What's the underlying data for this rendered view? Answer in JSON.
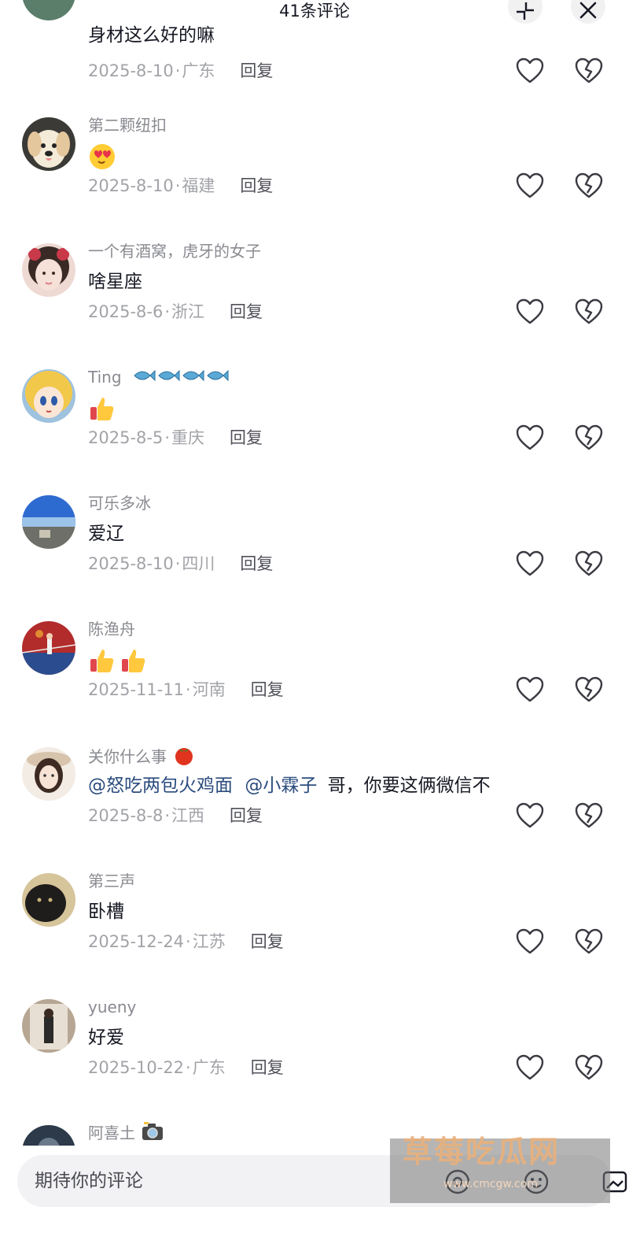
{
  "header": {
    "title": "41条评论"
  },
  "comments": [
    {
      "username": "",
      "content": "身材这么好的嘛",
      "date": "2025-8-10",
      "location": "广东",
      "reply": "回复",
      "avatar": "partial-avatar"
    },
    {
      "username": "第二颗纽扣",
      "content": "",
      "emoji": [
        "heart-eyes-emoji"
      ],
      "date": "2025-8-10",
      "location": "福建",
      "reply": "回复",
      "avatar": "puppy-avatar"
    },
    {
      "username": "一个有酒窝，虎牙的女子",
      "content": "啥星座",
      "date": "2025-8-6",
      "location": "浙江",
      "reply": "回复",
      "avatar": "girl-bow-avatar"
    },
    {
      "username": "Ting",
      "username_suffix_icons": [
        "fish-icon",
        "fish-icon",
        "fish-icon",
        "fish-icon"
      ],
      "content": "",
      "emoji": [
        "thumbs-up-emoji"
      ],
      "date": "2025-8-5",
      "location": "重庆",
      "reply": "回复",
      "avatar": "anime-girl-avatar"
    },
    {
      "username": "可乐多冰",
      "content": "爱辽",
      "date": "2025-8-10",
      "location": "四川",
      "reply": "回复",
      "avatar": "sky-landscape-avatar"
    },
    {
      "username": "陈渔舟",
      "content": "",
      "emoji": [
        "thumbs-up-emoji",
        "thumbs-up-emoji"
      ],
      "date": "2025-11-11",
      "location": "河南",
      "reply": "回复",
      "avatar": "basketball-avatar"
    },
    {
      "username": "关你什么事",
      "username_suffix_icons": [
        "tomato-icon"
      ],
      "mentions": [
        "@怒吃两包火鸡面",
        "@小霖子"
      ],
      "content": "哥，你要这俩微信不",
      "date": "2025-8-8",
      "location": "江西",
      "reply": "回复",
      "avatar": "girl-hat-avatar"
    },
    {
      "username": "第三声",
      "content": "卧槽",
      "date": "2025-12-24",
      "location": "江苏",
      "reply": "回复",
      "avatar": "dark-cat-avatar"
    },
    {
      "username": "yueny",
      "content": "好爱",
      "date": "2025-10-22",
      "location": "广东",
      "reply": "回复",
      "avatar": "mirror-selfie-avatar"
    },
    {
      "username": "阿喜土",
      "username_suffix_icons": [
        "camera-icon"
      ],
      "content": "",
      "date": "",
      "location": "",
      "reply": "",
      "avatar": "dark-avatar"
    }
  ],
  "input": {
    "placeholder": "期待你的评论"
  },
  "watermark": {
    "title": "草莓吃瓜网",
    "url": "www.cmcgw.com"
  },
  "colors": {
    "username": "#8a8b91",
    "meta": "#a2a3a8",
    "mention": "#2b4c7e",
    "text": "#161823"
  }
}
